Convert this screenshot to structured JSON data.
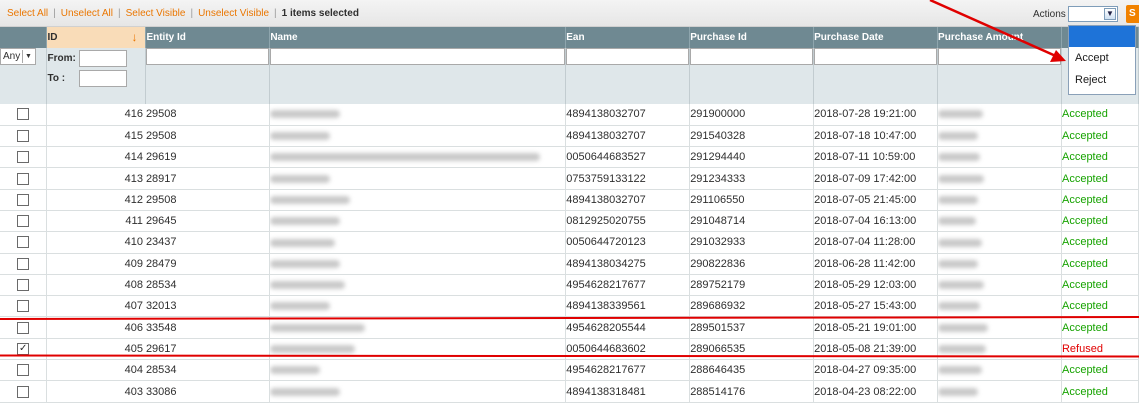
{
  "massaction": {
    "select_all": "Select All",
    "unselect_all": "Unselect All",
    "select_visible": "Select Visible",
    "unselect_visible": "Unselect Visible",
    "separator": "|",
    "selected_count": "1 items selected",
    "actions_label": "Actions",
    "submit_label": "S",
    "dropdown_options": [
      "",
      "Accept",
      "Reject"
    ]
  },
  "columns": [
    "",
    "ID",
    "Entity Id",
    "Name",
    "Ean",
    "Purchase Id",
    "Purchase Date",
    "Purchase Amount",
    ""
  ],
  "filters": {
    "massaction_select": "Any",
    "id_from_label": "From:",
    "id_to_label": "To :"
  },
  "rows": [
    {
      "checked": false,
      "id": "416",
      "entity_id": "29508",
      "ean": "4894138032707",
      "purchase_id": "291900000",
      "purchase_date": "2018-07-28 19:21:00",
      "status": "Accepted"
    },
    {
      "checked": false,
      "id": "415",
      "entity_id": "29508",
      "ean": "4894138032707",
      "purchase_id": "291540328",
      "purchase_date": "2018-07-18 10:47:00",
      "status": "Accepted"
    },
    {
      "checked": false,
      "id": "414",
      "entity_id": "29619",
      "ean": "0050644683527",
      "purchase_id": "291294440",
      "purchase_date": "2018-07-11 10:59:00",
      "status": "Accepted"
    },
    {
      "checked": false,
      "id": "413",
      "entity_id": "28917",
      "ean": "0753759133122",
      "purchase_id": "291234333",
      "purchase_date": "2018-07-09 17:42:00",
      "status": "Accepted"
    },
    {
      "checked": false,
      "id": "412",
      "entity_id": "29508",
      "ean": "4894138032707",
      "purchase_id": "291106550",
      "purchase_date": "2018-07-05 21:45:00",
      "status": "Accepted"
    },
    {
      "checked": false,
      "id": "411",
      "entity_id": "29645",
      "ean": "0812925020755",
      "purchase_id": "291048714",
      "purchase_date": "2018-07-04 16:13:00",
      "status": "Accepted"
    },
    {
      "checked": false,
      "id": "410",
      "entity_id": "23437",
      "ean": "0050644720123",
      "purchase_id": "291032933",
      "purchase_date": "2018-07-04 11:28:00",
      "status": "Accepted"
    },
    {
      "checked": false,
      "id": "409",
      "entity_id": "28479",
      "ean": "4894138034275",
      "purchase_id": "290822836",
      "purchase_date": "2018-06-28 11:42:00",
      "status": "Accepted"
    },
    {
      "checked": false,
      "id": "408",
      "entity_id": "28534",
      "ean": "4954628217677",
      "purchase_id": "289752179",
      "purchase_date": "2018-05-29 12:03:00",
      "status": "Accepted"
    },
    {
      "checked": false,
      "id": "407",
      "entity_id": "32013",
      "ean": "4894138339561",
      "purchase_id": "289686932",
      "purchase_date": "2018-05-27 15:43:00",
      "status": "Accepted"
    },
    {
      "checked": false,
      "id": "406",
      "entity_id": "33548",
      "ean": "4954628205544",
      "purchase_id": "289501537",
      "purchase_date": "2018-05-21 19:01:00",
      "status": "Accepted"
    },
    {
      "checked": true,
      "id": "405",
      "entity_id": "29617",
      "ean": "0050644683602",
      "purchase_id": "289066535",
      "purchase_date": "2018-05-08 21:39:00",
      "status": "Refused"
    },
    {
      "checked": false,
      "id": "404",
      "entity_id": "28534",
      "ean": "4954628217677",
      "purchase_id": "288646435",
      "purchase_date": "2018-04-27 09:35:00",
      "status": "Accepted"
    },
    {
      "checked": false,
      "id": "403",
      "entity_id": "33086",
      "ean": "4894138318481",
      "purchase_id": "288514176",
      "purchase_date": "2018-04-23 08:22:00",
      "status": "Accepted"
    }
  ],
  "colors": {
    "accent": "#ea7601",
    "header_bg": "#6f8992",
    "accepted": "#16a300",
    "refused": "#e10000",
    "annotation": "#e00000"
  }
}
